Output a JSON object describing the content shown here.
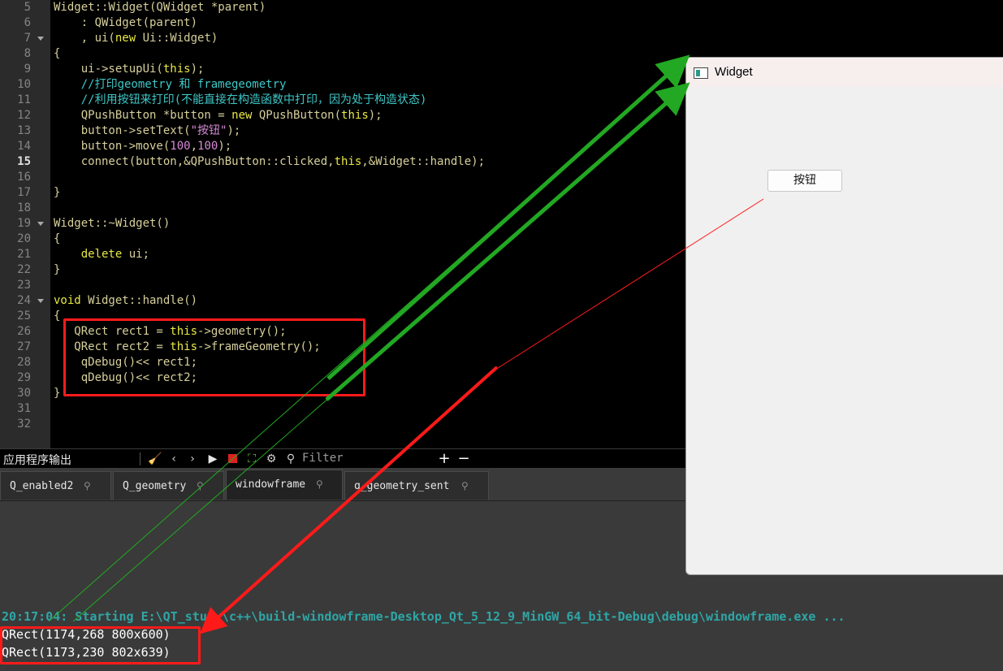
{
  "editor": {
    "lines": [
      {
        "n": "5",
        "fold": false,
        "text": "Widget::Widget(QWidget *parent)"
      },
      {
        "n": "6",
        "fold": false,
        "text": "    : QWidget(parent)"
      },
      {
        "n": "7",
        "fold": true,
        "text": "    , ui(new Ui::Widget)"
      },
      {
        "n": "8",
        "fold": false,
        "text": "{"
      },
      {
        "n": "9",
        "fold": false,
        "text": "    ui->setupUi(this);"
      },
      {
        "n": "10",
        "fold": false,
        "text": "    //打印geometry 和 framegeometry"
      },
      {
        "n": "11",
        "fold": false,
        "text": "    //利用按钮来打印(不能直接在构造函数中打印，因为处于构造状态)"
      },
      {
        "n": "12",
        "fold": false,
        "text": "    QPushButton *button = new QPushButton(this);"
      },
      {
        "n": "13",
        "fold": false,
        "text": "    button->setText(\"按钮\");"
      },
      {
        "n": "14",
        "fold": false,
        "text": "    button->move(100,100);"
      },
      {
        "n": "15",
        "fold": false,
        "text": "    connect(button,&QPushButton::clicked,this,&Widget::handle);"
      },
      {
        "n": "16",
        "fold": false,
        "text": ""
      },
      {
        "n": "17",
        "fold": false,
        "text": "}"
      },
      {
        "n": "18",
        "fold": false,
        "text": ""
      },
      {
        "n": "19",
        "fold": true,
        "text": "Widget::~Widget()"
      },
      {
        "n": "20",
        "fold": false,
        "text": "{"
      },
      {
        "n": "21",
        "fold": false,
        "text": "    delete ui;"
      },
      {
        "n": "22",
        "fold": false,
        "text": "}"
      },
      {
        "n": "23",
        "fold": false,
        "text": ""
      },
      {
        "n": "24",
        "fold": true,
        "text": "void Widget::handle()"
      },
      {
        "n": "25",
        "fold": false,
        "text": "{"
      },
      {
        "n": "26",
        "fold": false,
        "text": "   QRect rect1 = this->geometry();"
      },
      {
        "n": "27",
        "fold": false,
        "text": "   QRect rect2 = this->frameGeometry();"
      },
      {
        "n": "28",
        "fold": false,
        "text": "    qDebug()<< rect1;"
      },
      {
        "n": "29",
        "fold": false,
        "text": "    qDebug()<< rect2;"
      },
      {
        "n": "30",
        "fold": false,
        "text": "}"
      },
      {
        "n": "31",
        "fold": false,
        "text": ""
      },
      {
        "n": "32",
        "fold": false,
        "text": ""
      }
    ],
    "current_line": "15"
  },
  "output_pane": {
    "title": "应用程序输出",
    "filter_placeholder": "Filter",
    "tabs": [
      {
        "label": "Q_enabled2",
        "active": false
      },
      {
        "label": "Q_geometry",
        "active": false
      },
      {
        "label": "windowframe",
        "active": true
      },
      {
        "label": "q_geometry_sent",
        "active": false
      }
    ],
    "lines": [
      {
        "kind": "start",
        "text": "20:17:04: Starting E:\\QT_study\\c++\\build-windowframe-Desktop_Qt_5_12_9_MinGW_64_bit-Debug\\debug\\windowframe.exe ..."
      },
      {
        "kind": "plain",
        "text": "QRect(1174,268 800x600)"
      },
      {
        "kind": "plain",
        "text": "QRect(1173,230 802x639)"
      }
    ]
  },
  "widget_window": {
    "title": "Widget",
    "button_label": "按钮"
  },
  "colors": {
    "annotation_red": "#ff1a1a",
    "annotation_green": "#22a822"
  }
}
